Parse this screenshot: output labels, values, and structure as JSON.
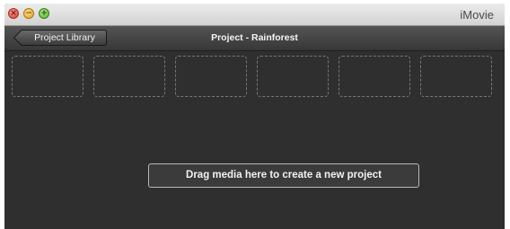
{
  "window": {
    "app_title": "iMovie",
    "controls": [
      {
        "name": "close",
        "color": "#e0483c"
      },
      {
        "name": "minimize",
        "color": "#e8a929"
      },
      {
        "name": "zoom",
        "color": "#5cbf2e"
      }
    ]
  },
  "toolbar": {
    "back_label": "Project Library",
    "project_title": "Project - Rainforest"
  },
  "content": {
    "placeholder_slot_count": 6,
    "drop_prompt": "Drag media here to create a new project"
  },
  "colors": {
    "background": "#2f2f2f",
    "slot_border": "#777777",
    "button_border": "#b8b8b8"
  }
}
